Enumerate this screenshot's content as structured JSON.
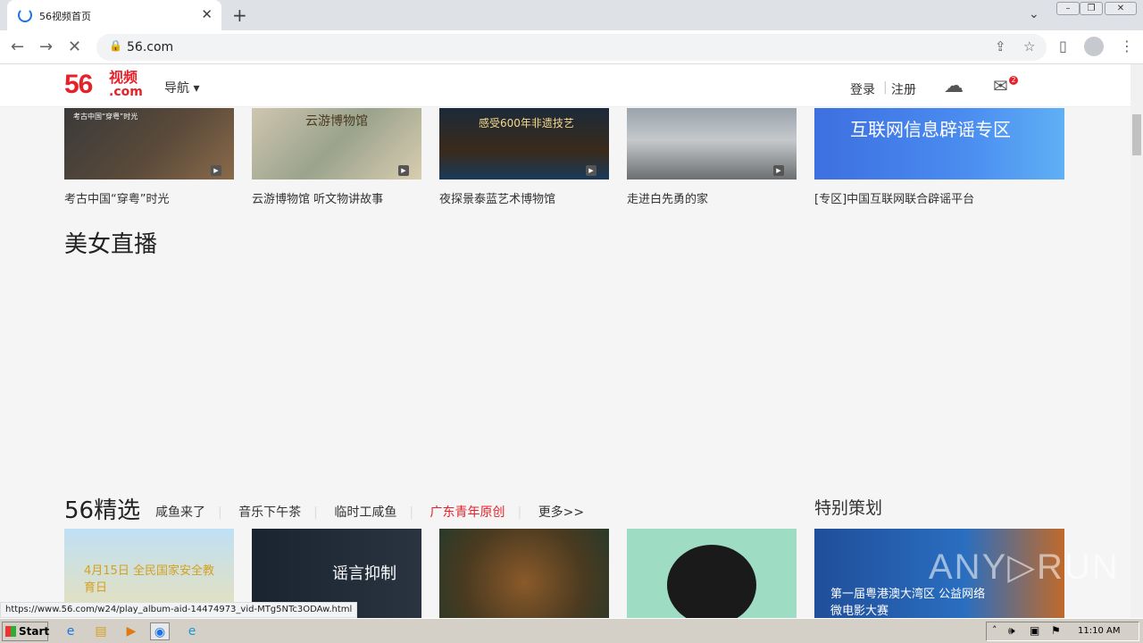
{
  "browser": {
    "tab_title": "56视频首页",
    "new_tab": "+",
    "close": "✕",
    "url": "56.com",
    "status_url": "https://www.56.com/w24/play_album-aid-14474973_vid-MTg5NTc3ODAw.html"
  },
  "header": {
    "logo_num": "56",
    "logo_cn": "视频",
    "logo_com": ".com",
    "nav": "导航 ▾",
    "login": "登录",
    "register": "注册",
    "mail_count": "2"
  },
  "top_cards": [
    {
      "caption": "考古中国“穿粤”时光",
      "thumb_text": "考古中国“穿粤”时光"
    },
    {
      "caption": "云游博物馆 听文物讲故事",
      "thumb_text": "云游博物馆"
    },
    {
      "caption": "夜探景泰蓝艺术博物馆",
      "thumb_text": "感受600年非遗技艺"
    },
    {
      "caption": "走进白先勇的家",
      "thumb_text": ""
    },
    {
      "caption": "[专区]中国互联网联合辟谣平台",
      "thumb_text": "互联网信息辟谣专区"
    }
  ],
  "sections": {
    "live_title": "美女直播",
    "select_title": "56精选",
    "select_tabs": [
      "咸鱼来了",
      "音乐下午茶",
      "临时工咸鱼",
      "广东青年原创",
      "更多>>"
    ],
    "special_title": "特别策划"
  },
  "bottom_cards": [
    {
      "thumb_text": "4月15日 全民国家安全教育日"
    },
    {
      "thumb_text": "谣言抑制"
    },
    {
      "thumb_text": ""
    },
    {
      "thumb_text": ""
    },
    {
      "thumb_text": "第一届粤港澳大湾区 公益网络微电影大赛"
    }
  ],
  "watermark": "ANY▷RUN",
  "taskbar": {
    "start": "Start",
    "time": "11:10 AM"
  }
}
